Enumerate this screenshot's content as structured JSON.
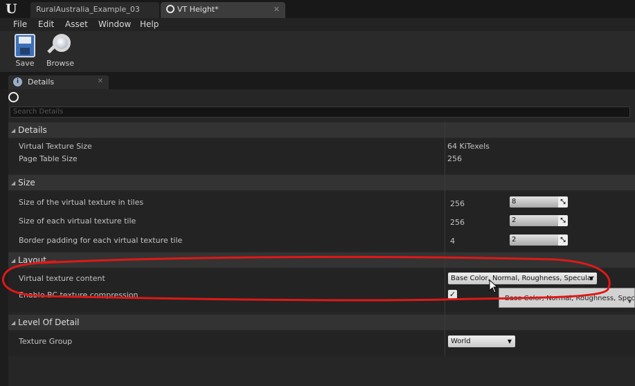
{
  "tabs": [
    {
      "label": "RuralAustralia_Example_03"
    },
    {
      "label": "VT Height*"
    }
  ],
  "menu": [
    "File",
    "Edit",
    "Asset",
    "Window",
    "Help"
  ],
  "toolbar": {
    "save_label": "Save",
    "browse_label": "Browse"
  },
  "panel": {
    "tab_label": "Details"
  },
  "search": {
    "placeholder": "Search Details"
  },
  "sections": {
    "details": {
      "title": "Details",
      "rows": [
        {
          "label": "Virtual Texture Size",
          "value": "64 KiTexels"
        },
        {
          "label": "Page Table Size",
          "value": "256"
        }
      ]
    },
    "size": {
      "title": "Size",
      "rows": [
        {
          "label": "Size of the virtual texture in tiles",
          "value": "256",
          "input": "8"
        },
        {
          "label": "Size of each virtual texture tile",
          "value": "256",
          "input": "2"
        },
        {
          "label": "Border padding for each virtual texture tile",
          "value": "4",
          "input": "2"
        }
      ]
    },
    "layout": {
      "title": "Layout",
      "content_label": "Virtual texture content",
      "content_value": "Base Color, Normal, Roughness, Specular",
      "bc_label": "Enable BC texture compression",
      "bc_checked": true
    },
    "lod": {
      "title": "Level Of Detail",
      "texture_group_label": "Texture Group",
      "texture_group_value": "World"
    }
  },
  "dropdown_popup": {
    "option": "Base Color, Normal, Roughness, Specular"
  },
  "colors": {
    "annotation": "#e01818",
    "background": "#1d1d1d",
    "panel": "#262626"
  }
}
